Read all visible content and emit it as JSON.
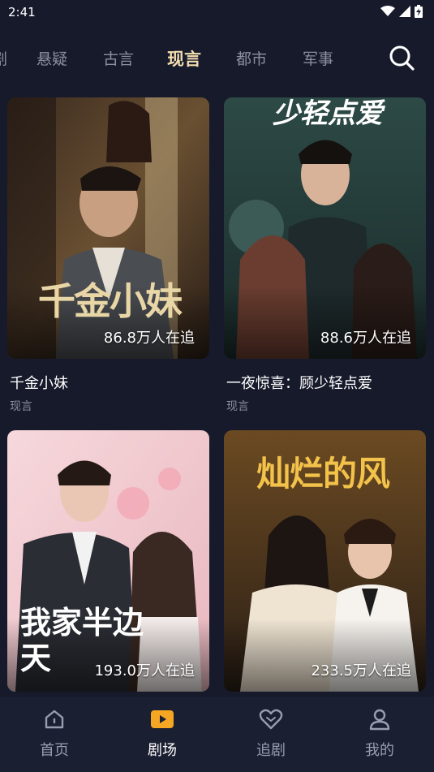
{
  "status_bar": {
    "time": "2:41"
  },
  "tabs": [
    {
      "label": "...",
      "active": false
    },
    {
      "label": "悬疑",
      "active": false
    },
    {
      "label": "古言",
      "active": false
    },
    {
      "label": "现言",
      "active": true
    },
    {
      "label": "都市",
      "active": false
    },
    {
      "label": "军事",
      "active": false
    }
  ],
  "cards": [
    {
      "title": "千金小妹",
      "genre": "现言",
      "followers": "86.8万人在追",
      "poster_text": "千金小妹"
    },
    {
      "title": "一夜惊喜：顾少轻点爱",
      "genre": "现言",
      "followers": "88.6万人在追",
      "poster_text": "少轻点爱"
    },
    {
      "title": "",
      "genre": "",
      "followers": "193.0万人在追",
      "poster_text": "我家半边天"
    },
    {
      "title": "",
      "genre": "",
      "followers": "233.5万人在追",
      "poster_text": "灿烂的风"
    }
  ],
  "bottom_nav": [
    {
      "label": "首页",
      "icon": "home-icon",
      "active": false
    },
    {
      "label": "剧场",
      "icon": "theater-icon",
      "active": true
    },
    {
      "label": "追剧",
      "icon": "heart-icon",
      "active": false
    },
    {
      "label": "我的",
      "icon": "user-icon",
      "active": false
    }
  ],
  "colors": {
    "background": "#161a2b",
    "active_tab": "#f3deb0",
    "accent": "#f5a623",
    "muted": "#8c8fa0"
  }
}
